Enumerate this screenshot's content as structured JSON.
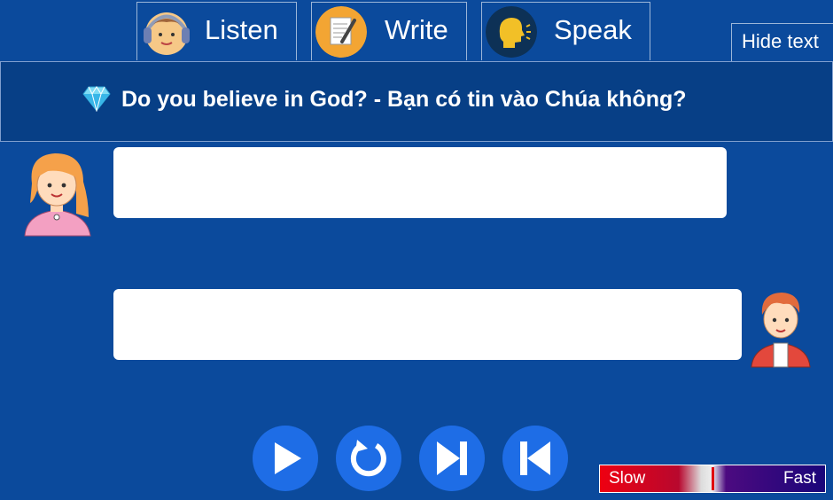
{
  "tabs": {
    "listen": {
      "label": "Listen",
      "icon": "headphones-face-icon"
    },
    "write": {
      "label": "Write",
      "icon": "notepad-pencil-icon"
    },
    "speak": {
      "label": "Speak",
      "icon": "speaking-head-icon"
    }
  },
  "hide_text_label": "Hide text",
  "lesson": {
    "title": "Do you believe in God? - Bạn có tin vào Chúa không?",
    "icon": "diamond-icon"
  },
  "dialogue": [
    {
      "speaker": "girl",
      "avatar": "girl-avatar",
      "text": ""
    },
    {
      "speaker": "boy",
      "avatar": "boy-avatar",
      "text": ""
    }
  ],
  "controls": [
    {
      "name": "play-button",
      "icon": "play-icon"
    },
    {
      "name": "replay-button",
      "icon": "replay-icon"
    },
    {
      "name": "next-button",
      "icon": "skip-next-icon"
    },
    {
      "name": "previous-button",
      "icon": "skip-previous-icon"
    }
  ],
  "speed": {
    "slow_label": "Slow",
    "fast_label": "Fast",
    "value": 0.5
  },
  "colors": {
    "background": "#0b4a9c",
    "title_bar": "#073f86",
    "control_button": "#1e6de6",
    "slow": "#ee0011",
    "fast": "#1a067a"
  }
}
